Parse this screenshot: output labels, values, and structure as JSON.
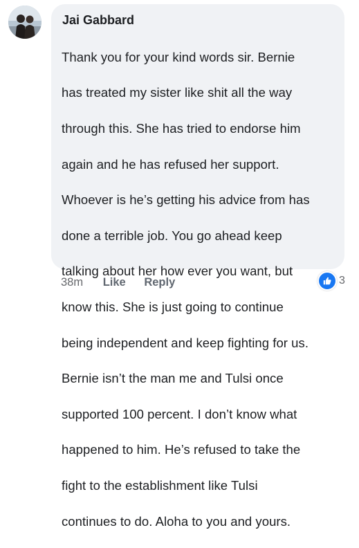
{
  "comment": {
    "author": "Jai Gabbard",
    "lines": [
      "Thank you for your kind words sir. Bernie",
      "has treated my sister like shit all the way",
      "through this. She has tried to endorse him",
      "again and he has refused her support.",
      "Whoever is he’s getting his advice from has",
      "done a terrible job. You go ahead keep",
      "talking about her how ever you want, but",
      "know this. She is just going to continue",
      "being independent and keep fighting for us.",
      "Bernie isn’t the man me and Tulsi once",
      "supported 100 percent. I don’t know what",
      "happened to him. He’s refused to take the",
      "fight to the establishment like Tulsi",
      "continues to do. Aloha to you and yours."
    ]
  },
  "actions": {
    "timestamp": "38m",
    "like_label": "Like",
    "reply_label": "Reply"
  },
  "reactions": {
    "icon": "thumbs-up-icon",
    "count": "3"
  },
  "colors": {
    "bubble_bg": "#f0f2f5",
    "text": "#1c1e21",
    "meta_text": "#65676b",
    "reaction_blue": "#1877f2"
  }
}
